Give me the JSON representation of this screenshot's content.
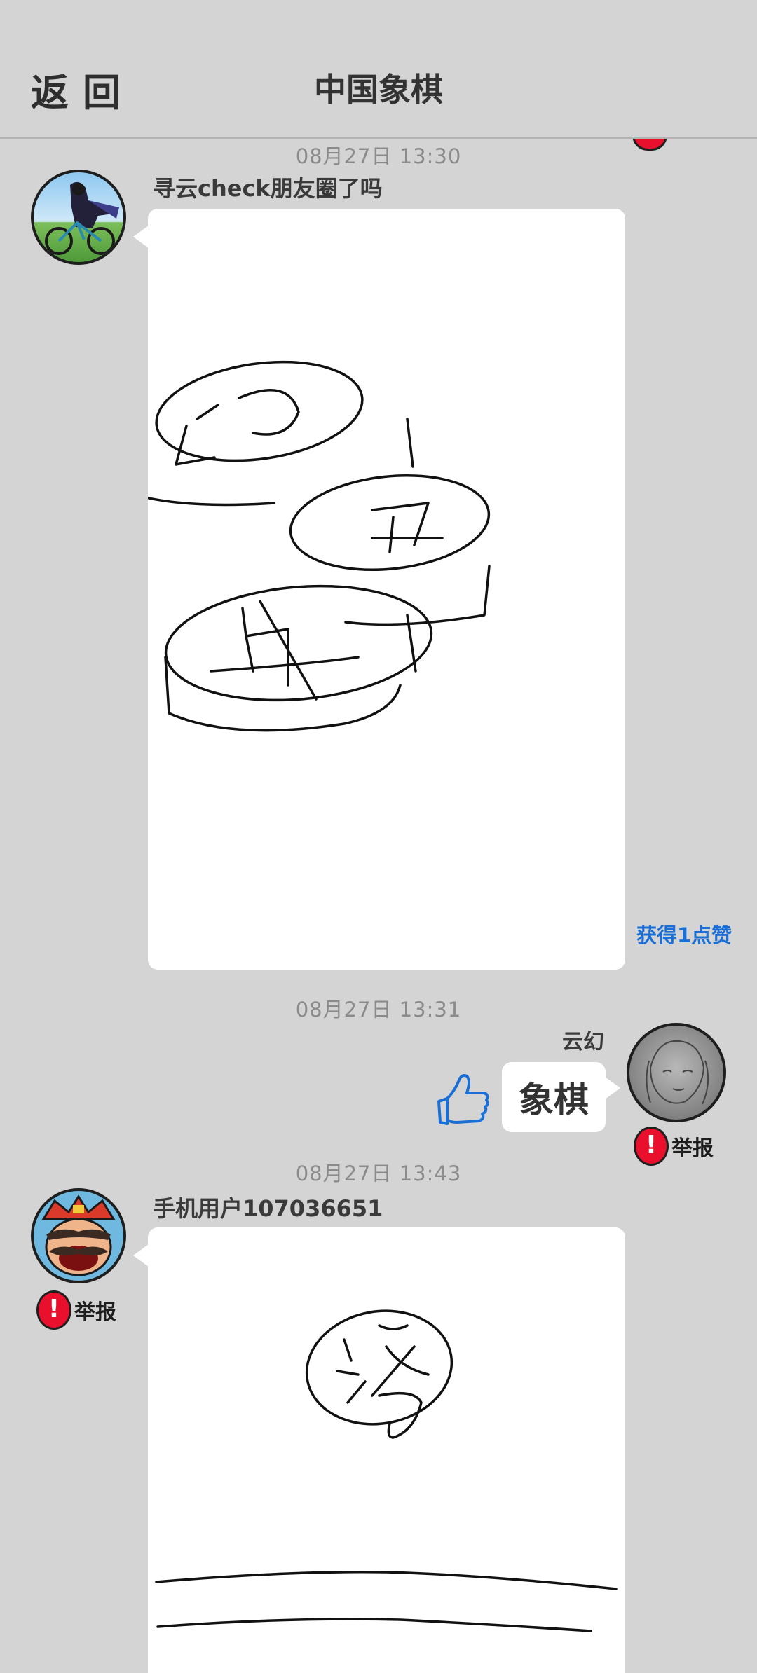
{
  "header": {
    "back_label": "返回",
    "title": "中国象棋"
  },
  "messages": [
    {
      "timestamp": "08月27日  13:30",
      "user": "寻云check朋友圈了吗",
      "likes": "获得1点赞"
    },
    {
      "timestamp": "08月27日  13:31",
      "user": "云幻",
      "text": "象棋",
      "report": "举报"
    },
    {
      "timestamp": "08月27日  13:43",
      "user": "手机用户107036651",
      "report": "举报"
    }
  ],
  "drawing_1_chars": [
    "砲",
    "馬",
    "車"
  ],
  "colors": {
    "background": "#d4d4d4",
    "link_blue": "#1a6fd6",
    "report_red": "#e8102c"
  },
  "icons": {
    "like": "thumbs-up-icon",
    "report": "exclamation-icon"
  }
}
